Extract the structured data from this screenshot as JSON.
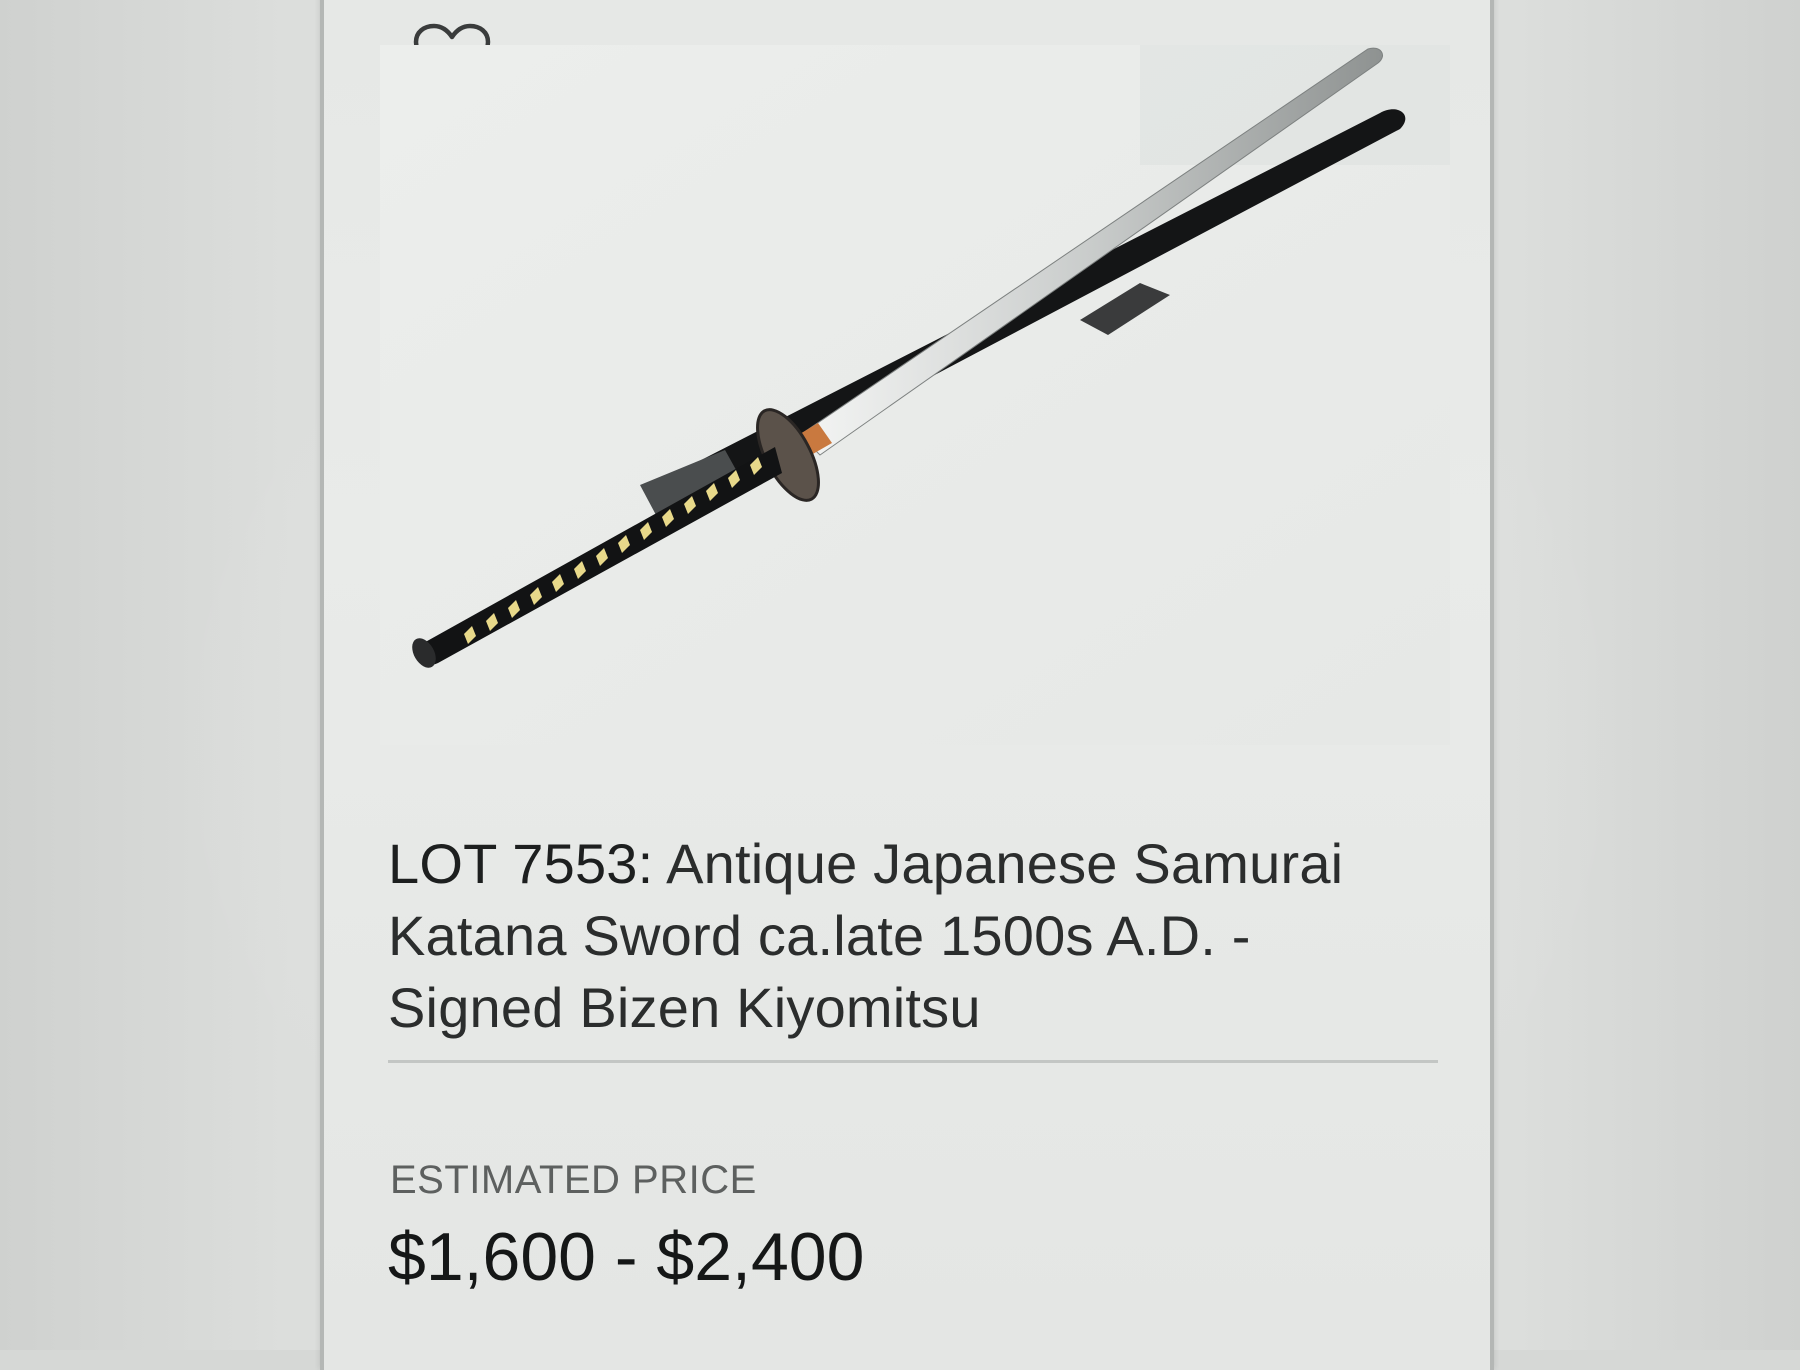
{
  "lot_card": {
    "favorite_icon": "heart-outline-icon",
    "lot_number": "LOT 7553:",
    "title_line_1": "Antique Japanese Samurai",
    "title_line_2": "Katana Sword ca.late 1500s A.D. -",
    "title_line_3": "- Signed Bizen Kiyomitsu",
    "title_line_3_text": "Signed Bizen Kiyomitsu",
    "estimate_label": "ESTIMATED PRICE",
    "estimate_value": "$1,600 - $2,400",
    "image_subject": "katana-sword-with-scabbard"
  },
  "colors": {
    "page_bg": "#d6d8d6",
    "card_bg": "#e8eae8",
    "title_text": "#2b2d2d",
    "label_text": "#5d605f",
    "price_text": "#151717"
  }
}
